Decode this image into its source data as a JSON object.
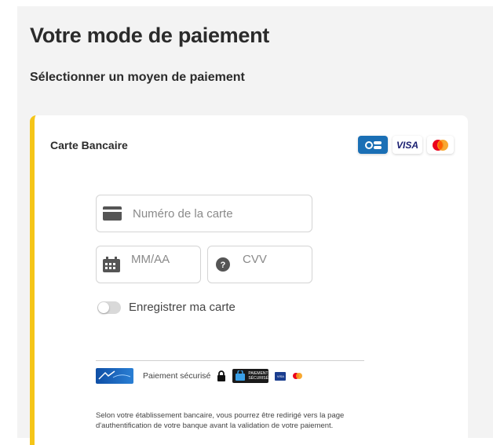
{
  "header": {
    "title": "Votre mode de paiement",
    "subtitle": "Sélectionner un moyen de paiement"
  },
  "card": {
    "title": "Carte Bancaire",
    "brands": [
      "CB",
      "VISA",
      "Mastercard"
    ],
    "accent_color": "#f5c518",
    "fields": {
      "card_number_placeholder": "Numéro de la carte",
      "expiry_placeholder": "MM/AA",
      "cvv_placeholder": "CVV"
    },
    "save_card": {
      "label": "Enregistrer ma carte",
      "checked": false
    },
    "secure": {
      "label": "Paiement sécurisé",
      "badge_line1": "PAIEMENT",
      "badge_line2": "SÉCURISÉ"
    },
    "notice": "Selon votre établissement bancaire, vous pourrez être redirigé vers la page d'authentification de votre banque avant la validation de votre paiement."
  }
}
